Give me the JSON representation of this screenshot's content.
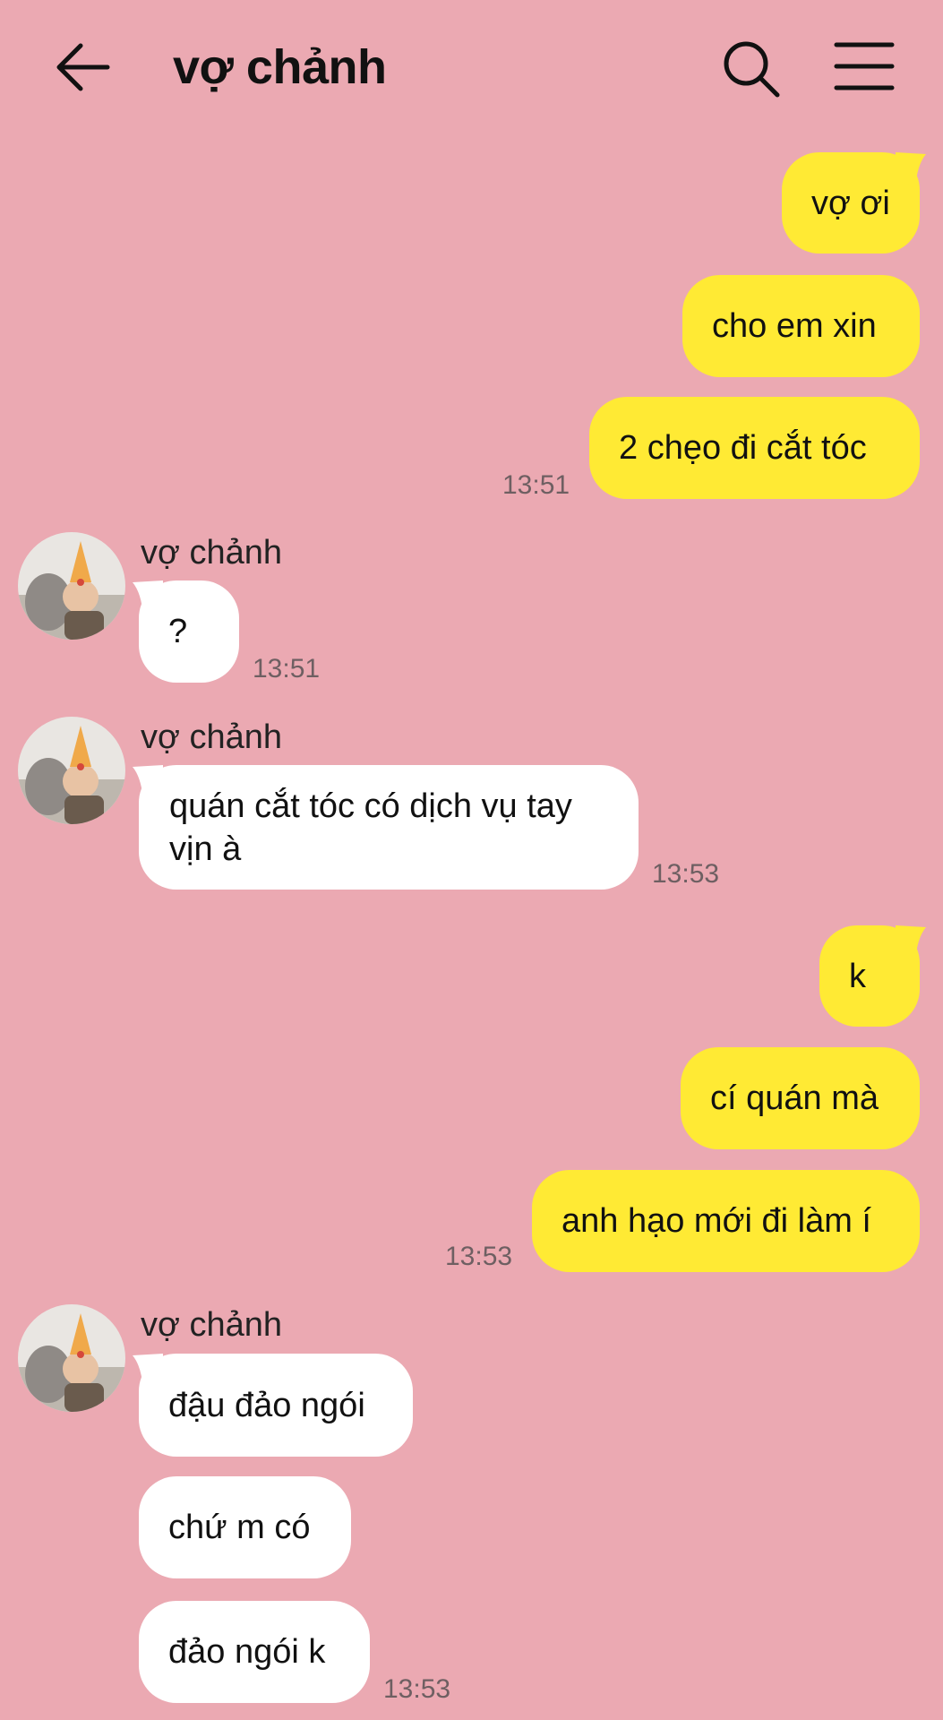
{
  "header": {
    "title": "vợ chảnh",
    "back_icon": "arrow-left-icon",
    "search_icon": "search-icon",
    "menu_icon": "hamburger-menu-icon"
  },
  "colors": {
    "background": "#eba9b2",
    "outgoing_bubble": "#ffea34",
    "incoming_bubble": "#ffffff",
    "timestamp": "#6e5f62"
  },
  "messages": {
    "m1": {
      "text": "vợ ơi"
    },
    "m2": {
      "text": "cho em xin"
    },
    "m3": {
      "text": "2 chẹo đi cắt tóc",
      "time": "13:51"
    },
    "m4": {
      "sender": "vợ chảnh",
      "text": "?",
      "time": "13:51"
    },
    "m5": {
      "sender": "vợ chảnh",
      "text": "quán cắt tóc có dịch vụ tay vịn à",
      "time": "13:53"
    },
    "m6": {
      "text": "k"
    },
    "m7": {
      "text": "cí quán mà"
    },
    "m8": {
      "text": "anh hạo mới đi làm í",
      "time": "13:53"
    },
    "m9": {
      "sender": "vợ chảnh",
      "text": "đậu đảo ngói"
    },
    "m10": {
      "text": "chứ m có"
    },
    "m11": {
      "text": "đảo ngói k",
      "time": "13:53"
    }
  }
}
